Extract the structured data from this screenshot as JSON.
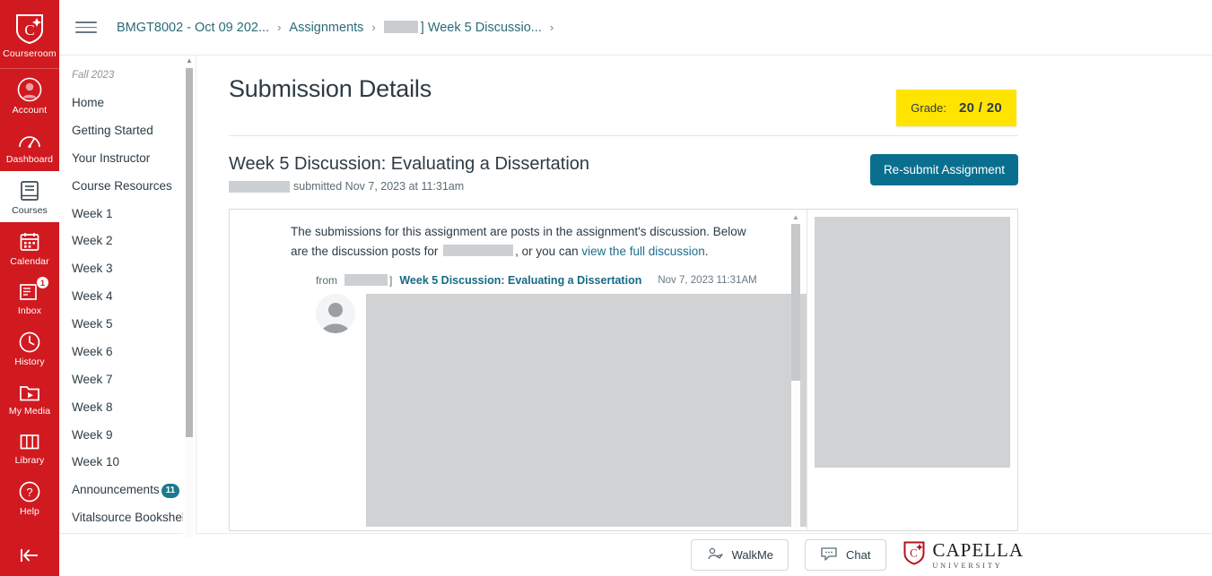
{
  "global_nav": {
    "logo": {
      "label": "Courseroom",
      "icon": "capella-shield-icon"
    },
    "items": [
      {
        "label": "Account",
        "icon": "account-avatar-icon",
        "active": false,
        "badge": ""
      },
      {
        "label": "Dashboard",
        "icon": "dashboard-gauge-icon",
        "active": false,
        "badge": ""
      },
      {
        "label": "Courses",
        "icon": "courses-book-icon",
        "active": true,
        "badge": ""
      },
      {
        "label": "Calendar",
        "icon": "calendar-icon",
        "active": false,
        "badge": ""
      },
      {
        "label": "Inbox",
        "icon": "inbox-icon",
        "active": false,
        "badge": "1"
      },
      {
        "label": "History",
        "icon": "history-clock-icon",
        "active": false,
        "badge": ""
      },
      {
        "label": "My Media",
        "icon": "my-media-play-icon",
        "active": false,
        "badge": ""
      },
      {
        "label": "Library",
        "icon": "library-books-icon",
        "active": false,
        "badge": ""
      },
      {
        "label": "Help",
        "icon": "help-question-icon",
        "active": false,
        "badge": ""
      }
    ],
    "collapse_icon": "collapse-left-arrow-icon"
  },
  "breadcrumb": {
    "menu_icon": "hamburger-menu-icon",
    "items": [
      {
        "label": "BMGT8002 - Oct 09 202...",
        "redacted_prefix": false
      },
      {
        "label": "Assignments",
        "redacted_prefix": false
      },
      {
        "label": "] Week 5 Discussio...",
        "redacted_prefix": true
      }
    ],
    "separator": "›"
  },
  "course_nav": {
    "term": "Fall 2023",
    "items": [
      {
        "label": "Home",
        "badge": ""
      },
      {
        "label": "Getting Started",
        "badge": ""
      },
      {
        "label": "Your Instructor",
        "badge": ""
      },
      {
        "label": "Course Resources",
        "badge": ""
      },
      {
        "label": "Week 1",
        "badge": ""
      },
      {
        "label": "Week 2",
        "badge": ""
      },
      {
        "label": "Week 3",
        "badge": ""
      },
      {
        "label": "Week 4",
        "badge": ""
      },
      {
        "label": "Week 5",
        "badge": ""
      },
      {
        "label": "Week 6",
        "badge": ""
      },
      {
        "label": "Week 7",
        "badge": ""
      },
      {
        "label": "Week 8",
        "badge": ""
      },
      {
        "label": "Week 9",
        "badge": ""
      },
      {
        "label": "Week 10",
        "badge": ""
      },
      {
        "label": "Announcements",
        "badge": "11"
      },
      {
        "label": "Vitalsource Bookshelf",
        "badge": ""
      }
    ]
  },
  "main": {
    "page_title": "Submission Details",
    "grade": {
      "label": "Grade:",
      "value": "20 / 20",
      "highlight_color": "#ffe400"
    },
    "assignment": {
      "title": "Week 5 Discussion: Evaluating a Dissertation",
      "submitted_text": "submitted Nov 7, 2023 at 11:31am",
      "resubmit_label": "Re-submit Assignment"
    },
    "preview": {
      "intro_line1": "The submissions for this assignment are posts in the assignment's discussion. Below",
      "intro_line2_before": "are the discussion posts for",
      "intro_line2_mid": ", or you can",
      "intro_link": "view the full discussion",
      "intro_end": ".",
      "post_from": "from",
      "post_bracket": "]",
      "post_title": "Week 5 Discussion: Evaluating a Dissertation",
      "post_date": "Nov 7, 2023 11:31AM"
    }
  },
  "footer": {
    "walkme_label": "WalkMe",
    "walkme_icon": "walkme-icon",
    "chat_label": "Chat",
    "chat_icon": "chat-bubble-icon",
    "brand_name": "CAPELLA",
    "brand_sub": "UNIVERSITY",
    "brand_icon": "capella-shield-icon"
  },
  "colors": {
    "nav_red": "#d01a20",
    "link_teal": "#1a6e8e",
    "button_blue": "#0a6f8f",
    "badge_teal": "#1a7b8c",
    "grade_yellow": "#ffe400"
  }
}
